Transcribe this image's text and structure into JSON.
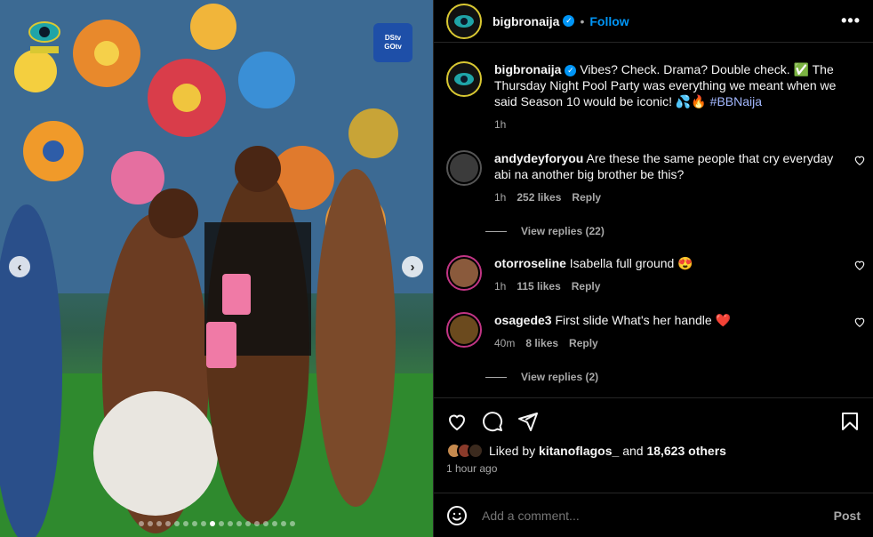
{
  "post": {
    "username": "bigbronaija",
    "separator": "•",
    "follow_label": "Follow",
    "more_icon": "more-horizontal-icon"
  },
  "caption": {
    "username": "bigbronaija",
    "text": "Vibes? Check. Drama? Double check. ✅ The Thursday Night Pool Party was everything we meant when we said Season 10 would be iconic! 💦🔥",
    "hashtag": "#BBNaija",
    "time": "1h"
  },
  "comments": [
    {
      "username": "andydeyforyou",
      "text": "Are these the same people that cry everyday abi na another big brother be this?",
      "time": "1h",
      "likes": "252 likes",
      "reply_label": "Reply",
      "view_replies": "View replies (22)",
      "avatar_color": "#3b3b3b"
    },
    {
      "username": "otorroseline",
      "text": "Isabella full ground 😍",
      "time": "1h",
      "likes": "115 likes",
      "reply_label": "Reply",
      "view_replies": "",
      "avatar_color": "#8a5a3c"
    },
    {
      "username": "osagede3",
      "text": "First slide What's her handle ❤️",
      "time": "40m",
      "likes": "8 likes",
      "reply_label": "Reply",
      "view_replies": "View replies (2)",
      "avatar_color": "#6b4a1e"
    }
  ],
  "likes": {
    "prefix": "Liked by",
    "user": "kitanoflagos_",
    "middle": "and",
    "others": "18,623 others",
    "ago": "1 hour ago"
  },
  "add_comment": {
    "placeholder": "Add a comment...",
    "post_label": "Post"
  },
  "media": {
    "brand_line1": "DStv",
    "brand_line2": "GOtv",
    "dots_total": 18,
    "dots_active_index": 8
  },
  "colors": {
    "accent": "#0095f6",
    "background": "#000000",
    "muted": "#a8a8a8",
    "hashtag": "#a3b8ff"
  }
}
